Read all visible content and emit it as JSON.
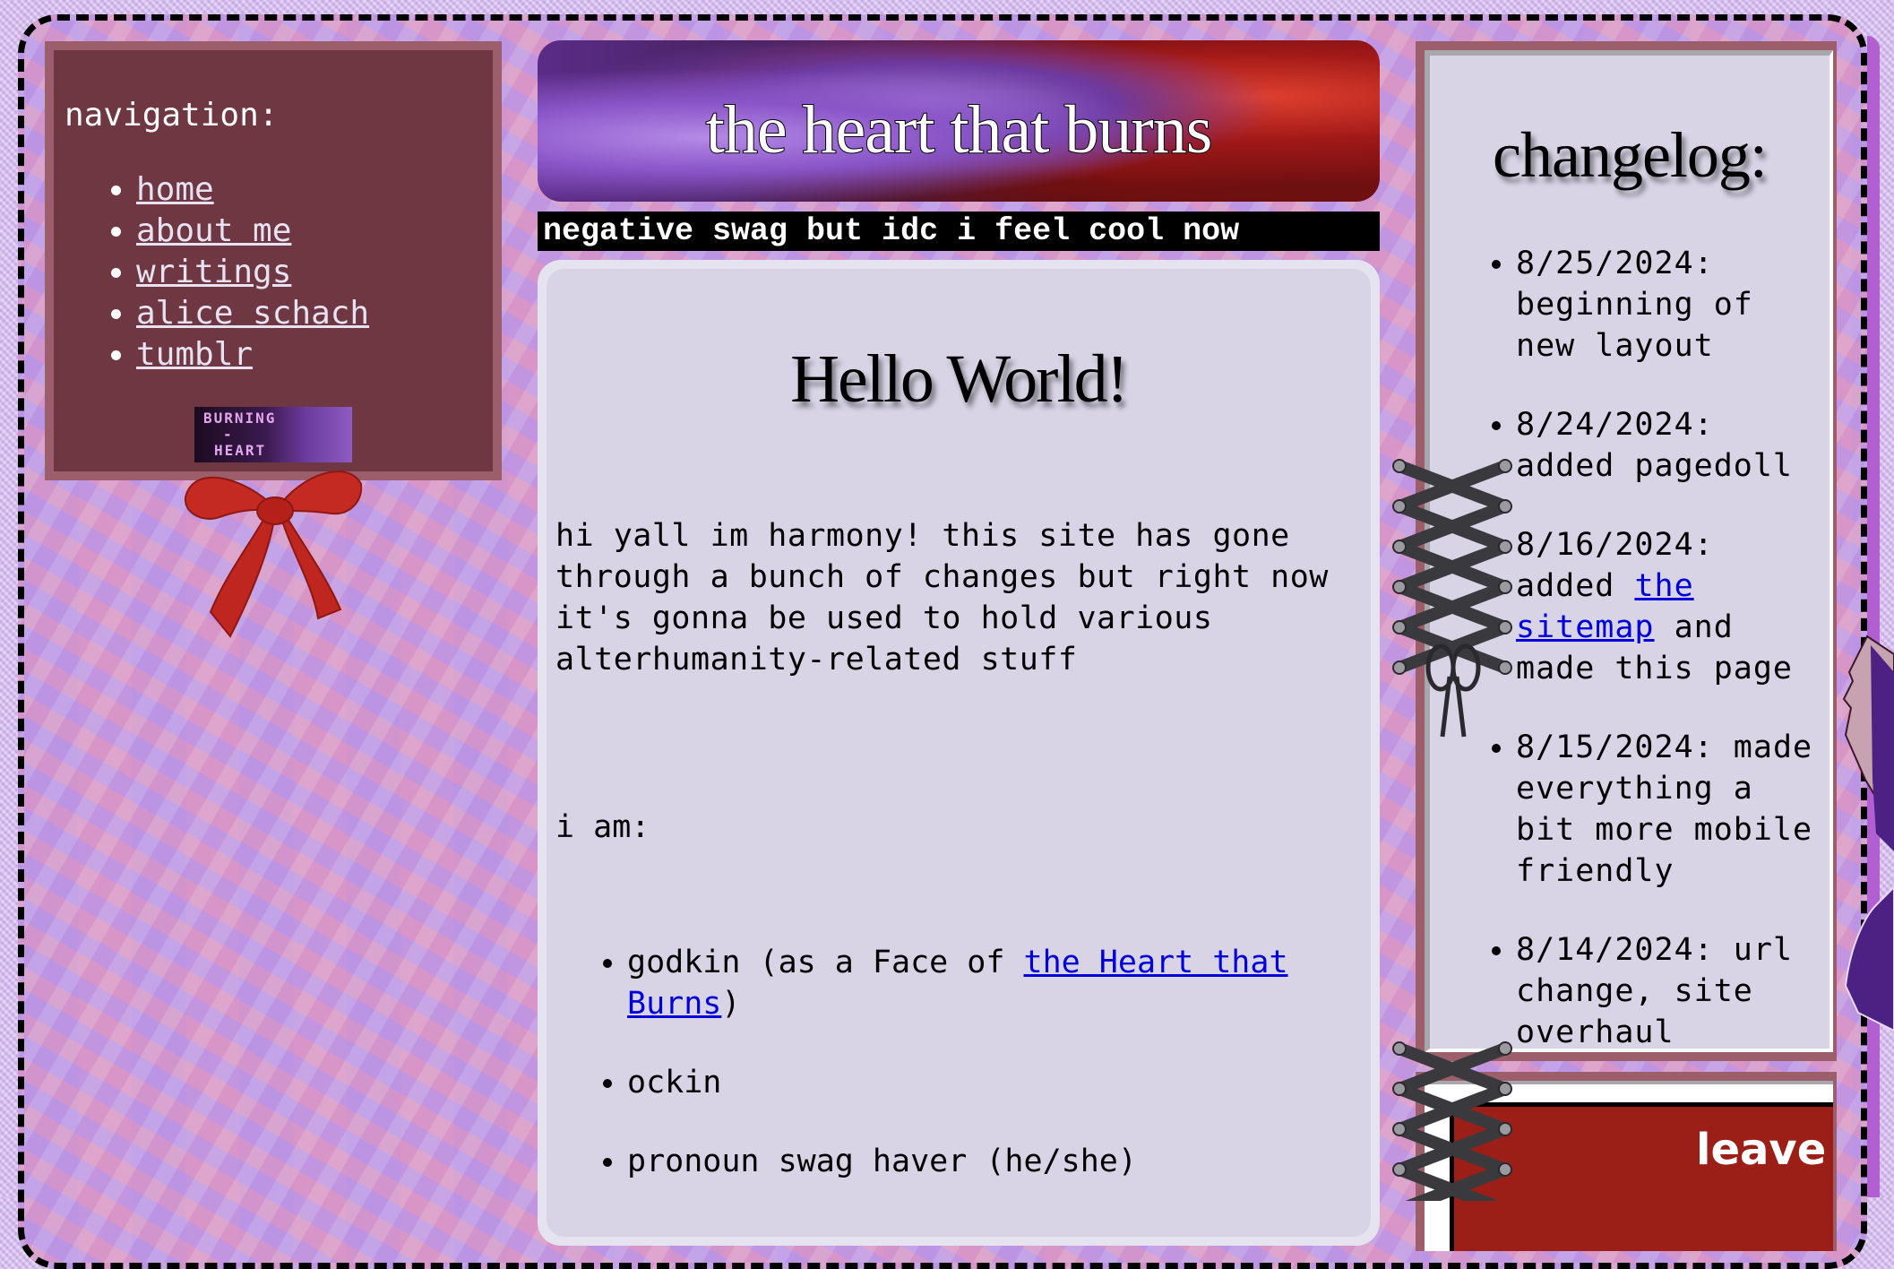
{
  "colors": {
    "nav_bg": "#6e3742",
    "nav_border": "#9c5e6a",
    "panel_bg": "#d8d4e6",
    "link_blue": "#0000d8",
    "leave_red": "#9b1f17"
  },
  "nav": {
    "title": "navigation:",
    "items": [
      {
        "label": "home"
      },
      {
        "label": "about me"
      },
      {
        "label": "writings"
      },
      {
        "label": "alice schach"
      },
      {
        "label": "tumblr"
      }
    ],
    "button": {
      "line1": "BURNING",
      "line2": "-",
      "line3": "HEART"
    }
  },
  "header": {
    "title": "the heart that burns",
    "tagline": "negative swag but idc i feel cool now"
  },
  "main": {
    "heading": "Hello World!",
    "intro": "hi yall im harmony! this site has gone through a bunch of changes but right now it's gonna be used to hold various alterhumanity-related stuff",
    "iam_label": "i am:",
    "items": [
      {
        "pre": "godkin (as a Face of ",
        "link": "the Heart that Burns",
        "post": ")"
      },
      {
        "text": "ockin"
      },
      {
        "text": "pronoun swag haver (he/she)"
      }
    ]
  },
  "changelog": {
    "title": "changelog:",
    "entries": [
      {
        "date": "8/25/2024:",
        "text": "beginning of new layout"
      },
      {
        "date": "8/24/2024:",
        "text": "added pagedoll"
      },
      {
        "date": "8/16/2024:",
        "pre": "added ",
        "link": "the sitemap",
        "post": " and made this page"
      },
      {
        "date": "8/15/2024:",
        "text": "made everything a bit more mobile friendly"
      },
      {
        "date": "8/14/2024:",
        "text": "url change, site overhaul"
      }
    ]
  },
  "leave": {
    "label": "leave"
  },
  "icons": {
    "bow": "red-bow-icon",
    "corset": "corset-lacing-icon",
    "pagedoll": "pagedoll-figure"
  }
}
